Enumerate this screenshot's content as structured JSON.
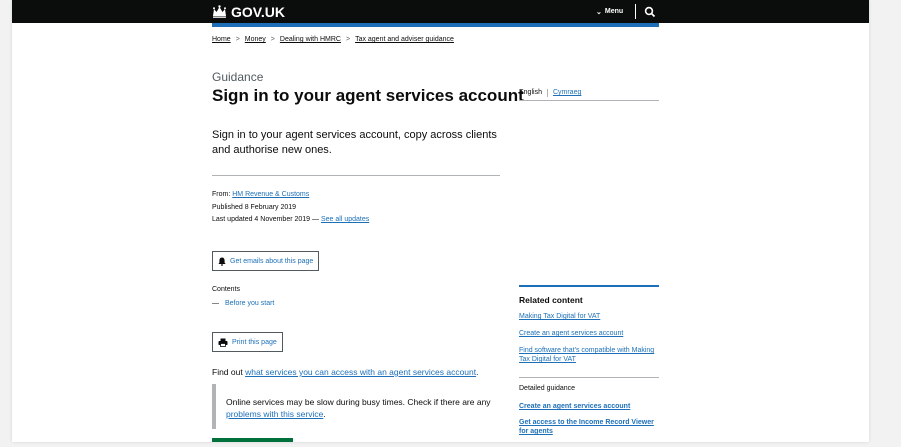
{
  "header": {
    "logo_text": "GOV.UK",
    "menu_label": "Menu",
    "accent_color": "#1d70b8"
  },
  "breadcrumb": [
    "Home",
    "Money",
    "Dealing with HMRC",
    "Tax agent and adviser guidance"
  ],
  "page": {
    "caption": "Guidance",
    "title": "Sign in to your agent services account",
    "lede": "Sign in to your agent services account, copy across clients and authorise new ones."
  },
  "languages": {
    "current": "English",
    "other": "Cymraeg"
  },
  "meta": {
    "from_label": "From:",
    "from_org": "HM Revenue & Customs",
    "published": "Published 8 February 2019",
    "updated": "Last updated 4 November 2019 —",
    "see_updates": "See all updates"
  },
  "buttons": {
    "emails": "Get emails about this page",
    "print": "Print this page"
  },
  "contents": {
    "label": "Contents",
    "items": [
      "Before you start"
    ]
  },
  "body": {
    "findout_prefix": "Find out",
    "findout_link": "what services you can access with an agent services account",
    "findout_suffix": ".",
    "inset_text": "Online services may be slow during busy times. Check if there are any",
    "inset_link": "problems with this service",
    "inset_suffix": "."
  },
  "related": {
    "heading": "Related content",
    "links": [
      "Making Tax Digital for VAT",
      "Create an agent services account",
      "Find software that's compatible with Making Tax Digital for VAT"
    ],
    "detailed_label": "Detailed guidance",
    "detailed_links": [
      "Create an agent services account",
      "Get access to the Income Record Viewer for agents"
    ]
  }
}
